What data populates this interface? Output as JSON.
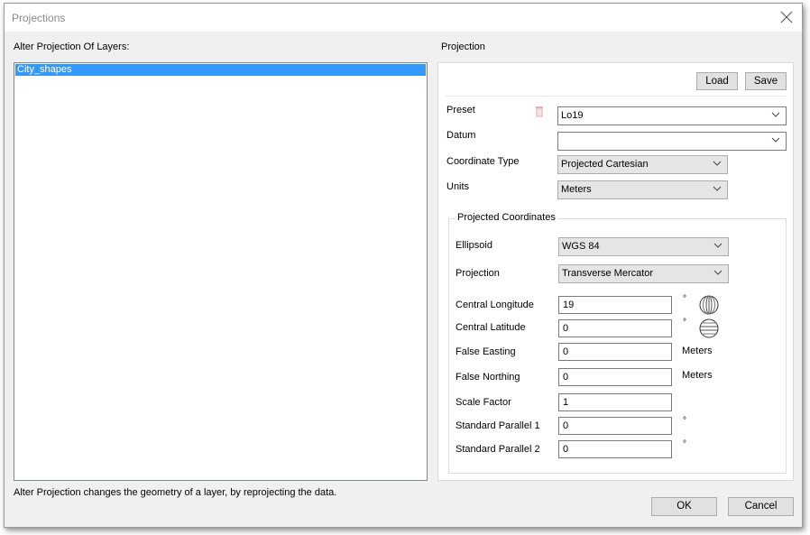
{
  "window": {
    "title": "Projections",
    "close_icon": "close-icon"
  },
  "left": {
    "heading": "Alter Projection Of Layers:",
    "layers": [
      {
        "name": "City_shapes",
        "selected": true
      }
    ],
    "footer_note": "Alter Projection changes the geometry of a layer, by reprojecting the data."
  },
  "right": {
    "heading": "Projection",
    "load_label": "Load",
    "save_label": "Save",
    "preset": {
      "label": "Preset",
      "value": "Lo19",
      "delete_icon": "trash-icon"
    },
    "datum": {
      "label": "Datum",
      "value": ""
    },
    "coordinate_type": {
      "label": "Coordinate Type",
      "value": "Projected Cartesian"
    },
    "units": {
      "label": "Units",
      "value": "Meters"
    },
    "projected_coordinates": {
      "title": "Projected Coordinates",
      "ellipsoid": {
        "label": "Ellipsoid",
        "value": "WGS 84"
      },
      "projection": {
        "label": "Projection",
        "value": "Transverse Mercator"
      },
      "central_longitude": {
        "label": "Central Longitude",
        "value": "19",
        "unit": "°",
        "icon": "globe-longitude-icon"
      },
      "central_latitude": {
        "label": "Central Latitude",
        "value": "0",
        "unit": "°",
        "icon": "globe-latitude-icon"
      },
      "false_easting": {
        "label": "False Easting",
        "value": "0",
        "unit": "Meters"
      },
      "false_northing": {
        "label": "False Northing",
        "value": "0",
        "unit": "Meters"
      },
      "scale_factor": {
        "label": "Scale Factor",
        "value": "1"
      },
      "standard_parallel_1": {
        "label": "Standard Parallel 1",
        "value": "0",
        "unit": "°"
      },
      "standard_parallel_2": {
        "label": "Standard Parallel 2",
        "value": "0",
        "unit": "°"
      }
    }
  },
  "buttons": {
    "ok_label": "OK",
    "cancel_label": "Cancel"
  },
  "colors": {
    "selection": "#3399ff",
    "dialog_bg": "#f0f0f0",
    "button_bg": "#e1e1e1"
  }
}
